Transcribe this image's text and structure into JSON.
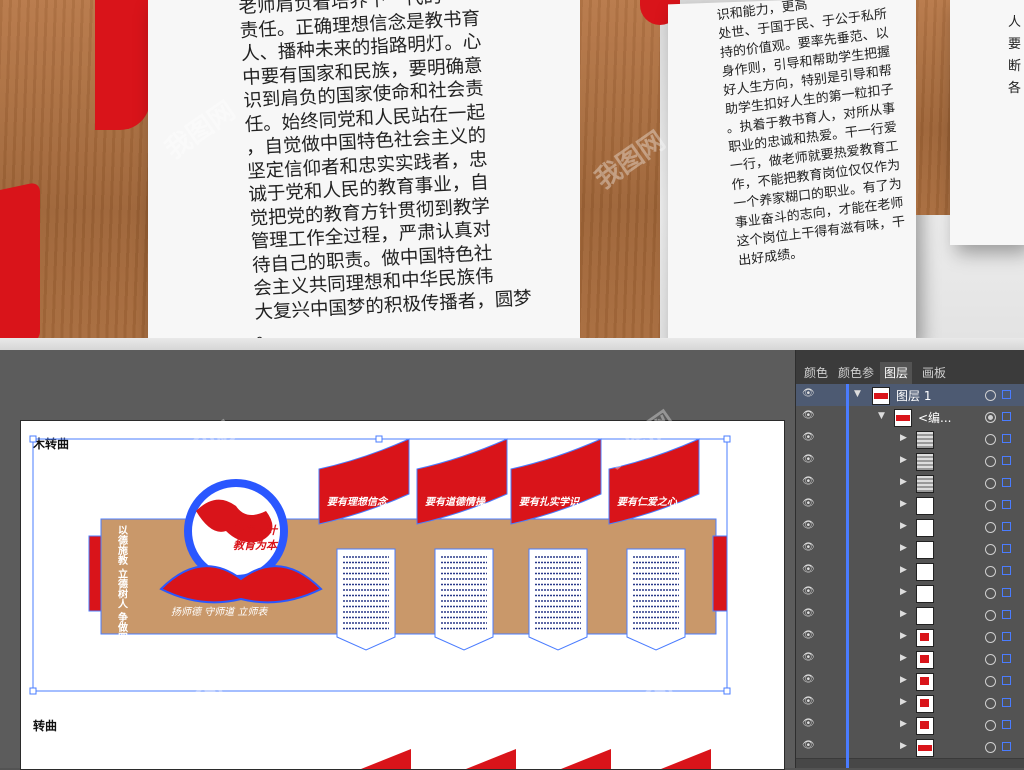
{
  "render": {
    "panel_left_lines": [
      "老师肩负着培养下一代的",
      "责任。正确理想信念是教书育",
      "人、播种未来的指路明灯。心",
      "中要有国家和民族，要明确意",
      "识到肩负的国家使命和社会责",
      "任。始终同党和人民站在一起",
      "，自觉做中国特色社会主义的",
      "坚定信仰者和忠实实践者，忠",
      "诚于党和人民的教育事业，自",
      "觉把党的教育方针贯彻到教学",
      "管理工作全过程，严肃认真对",
      "待自己的职责。做中国特色社",
      "会主义共同理想和中华民族伟",
      "大复兴中国梦的积极传播者，圆梦",
      "。"
    ],
    "panel_right_lines": [
      "识和能力，更高",
      "处世、于国于民、于公于私所",
      "持的价值观。要率先垂范、以",
      "身作则，引导和帮助学生把握",
      "好人生方向，特别是引导和帮",
      "助学生扣好人生的第一粒扣子",
      "。执着于教书育人，对所从事",
      "职业的忠诚和热爱。干一行爱",
      "一行，做老师就要热爱教育工",
      "作，不能把教育岗位仅仅作为",
      "一个养家糊口的职业。有了为",
      "事业奋斗的志向，才能在老师",
      "这个岗位上干得有滋有味，干",
      "出好成绩。"
    ],
    "panel_far_lines": [
      "人",
      "要",
      "断",
      "各"
    ]
  },
  "artboard": {
    "label_top": "木转曲",
    "label_bottom": "转曲",
    "banner_center_line1": "百年大计",
    "banner_center_line2": "教育为本",
    "vertical_motto": "以德施教 立德树人 争做四有好老师",
    "bottom_motto": "扬师德  守师道  立师表",
    "flags": [
      "要有理想信念",
      "要有道德情操",
      "要有扎实学识",
      "要有仁爱之心"
    ]
  },
  "panel": {
    "tabs": [
      "颜色",
      "颜色参",
      "图层",
      "画板"
    ],
    "active_tab": "图层",
    "layer_name": "图层 1",
    "sublayer_name": "<编...",
    "row_count": 17
  },
  "watermark": "我图网",
  "colors": {
    "accent_red": "#d9141a",
    "selection_blue": "#4a7cff",
    "panel_bg": "#535353",
    "wood": "#a86b3c"
  }
}
